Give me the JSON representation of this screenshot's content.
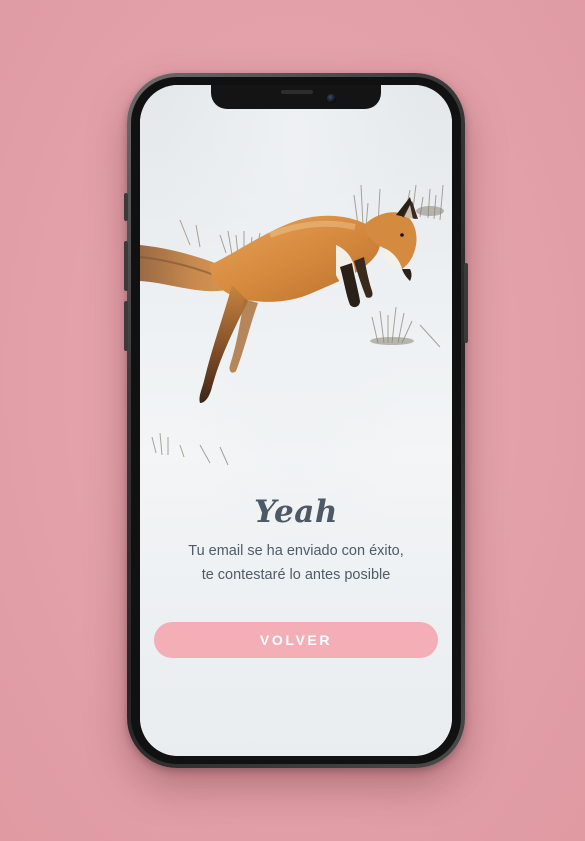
{
  "screen": {
    "title": "Yeah",
    "message_line1": "Tu email se ha enviado con éxito,",
    "message_line2": "te contestaré lo antes posible",
    "back_button_label": "VOLVER"
  },
  "colors": {
    "background": "#e5a1a9",
    "button": "#f4aeb6",
    "title_text": "#4d5966",
    "body_text": "#4f5b68"
  },
  "image": {
    "subject": "fox-jumping-in-snow"
  }
}
